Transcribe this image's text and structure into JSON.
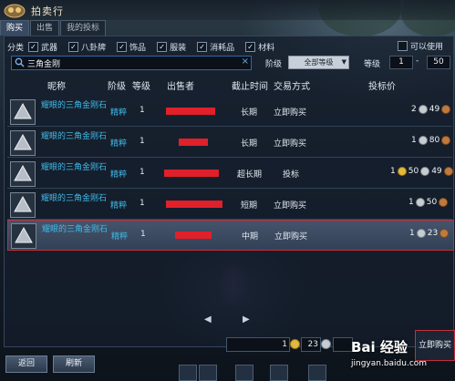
{
  "window": {
    "title": "拍卖行"
  },
  "tabs": [
    {
      "label": "购买",
      "active": true
    },
    {
      "label": "出售",
      "active": false
    },
    {
      "label": "我的投标",
      "active": false
    }
  ],
  "filters": {
    "label": "分类",
    "items": [
      {
        "label": "武器",
        "checked": true
      },
      {
        "label": "八卦牌",
        "checked": true
      },
      {
        "label": "饰品",
        "checked": true
      },
      {
        "label": "服装",
        "checked": true
      },
      {
        "label": "消耗品",
        "checked": true
      },
      {
        "label": "材料",
        "checked": true
      }
    ],
    "sale_option": {
      "label": "可以使用",
      "checked": false
    }
  },
  "search": {
    "value": "三角金刚",
    "clear": "×"
  },
  "rank": {
    "label": "阶级",
    "selected": "全部等级"
  },
  "level": {
    "label": "等级",
    "min": "1",
    "dash": "-",
    "max": "50"
  },
  "columns": {
    "name": "昵称",
    "rank": "阶级",
    "level": "等级",
    "seller": "出售者",
    "deadline": "截止时间",
    "trade_mode": "交易方式",
    "bid_price": "投标价"
  },
  "rows": [
    {
      "name": "耀眼的三角金刚石",
      "rank": "精粹",
      "level": "1",
      "deadline": "长期",
      "trade_mode": "立即购买",
      "gold": "",
      "silver": "2",
      "copper": "49",
      "selected": false
    },
    {
      "name": "耀眼的三角金刚石",
      "rank": "精粹",
      "level": "1",
      "deadline": "长期",
      "trade_mode": "立即购买",
      "gold": "",
      "silver": "1",
      "copper": "80",
      "selected": false
    },
    {
      "name": "耀眼的三角金刚石",
      "rank": "精粹",
      "level": "1",
      "deadline": "超长期",
      "trade_mode": "投标",
      "gold": "1",
      "silver": "50",
      "copper": "49",
      "selected": false
    },
    {
      "name": "耀眼的三角金刚石",
      "rank": "精粹",
      "level": "1",
      "deadline": "短期",
      "trade_mode": "立即购买",
      "gold": "",
      "silver": "1",
      "copper": "50",
      "selected": false
    },
    {
      "name": "耀眼的三角金刚石",
      "rank": "精粹",
      "level": "1",
      "deadline": "中期",
      "trade_mode": "立即购买",
      "gold": "",
      "silver": "1",
      "copper": "23",
      "selected": true
    }
  ],
  "pager": {
    "prev": "◀",
    "next": "▶"
  },
  "bottom": {
    "gold": "1",
    "silver": "23",
    "copper": "",
    "back_button": "返回",
    "refresh_button": "刷新",
    "buy_button": "立即购买"
  },
  "watermark": {
    "brand": "Bai 经验",
    "url": "jingyan.baidu.com"
  },
  "colors": {
    "accent_cyan": "#3fb9e8",
    "highlight_red": "#c0303a",
    "gold_coin": "#e2b840"
  }
}
